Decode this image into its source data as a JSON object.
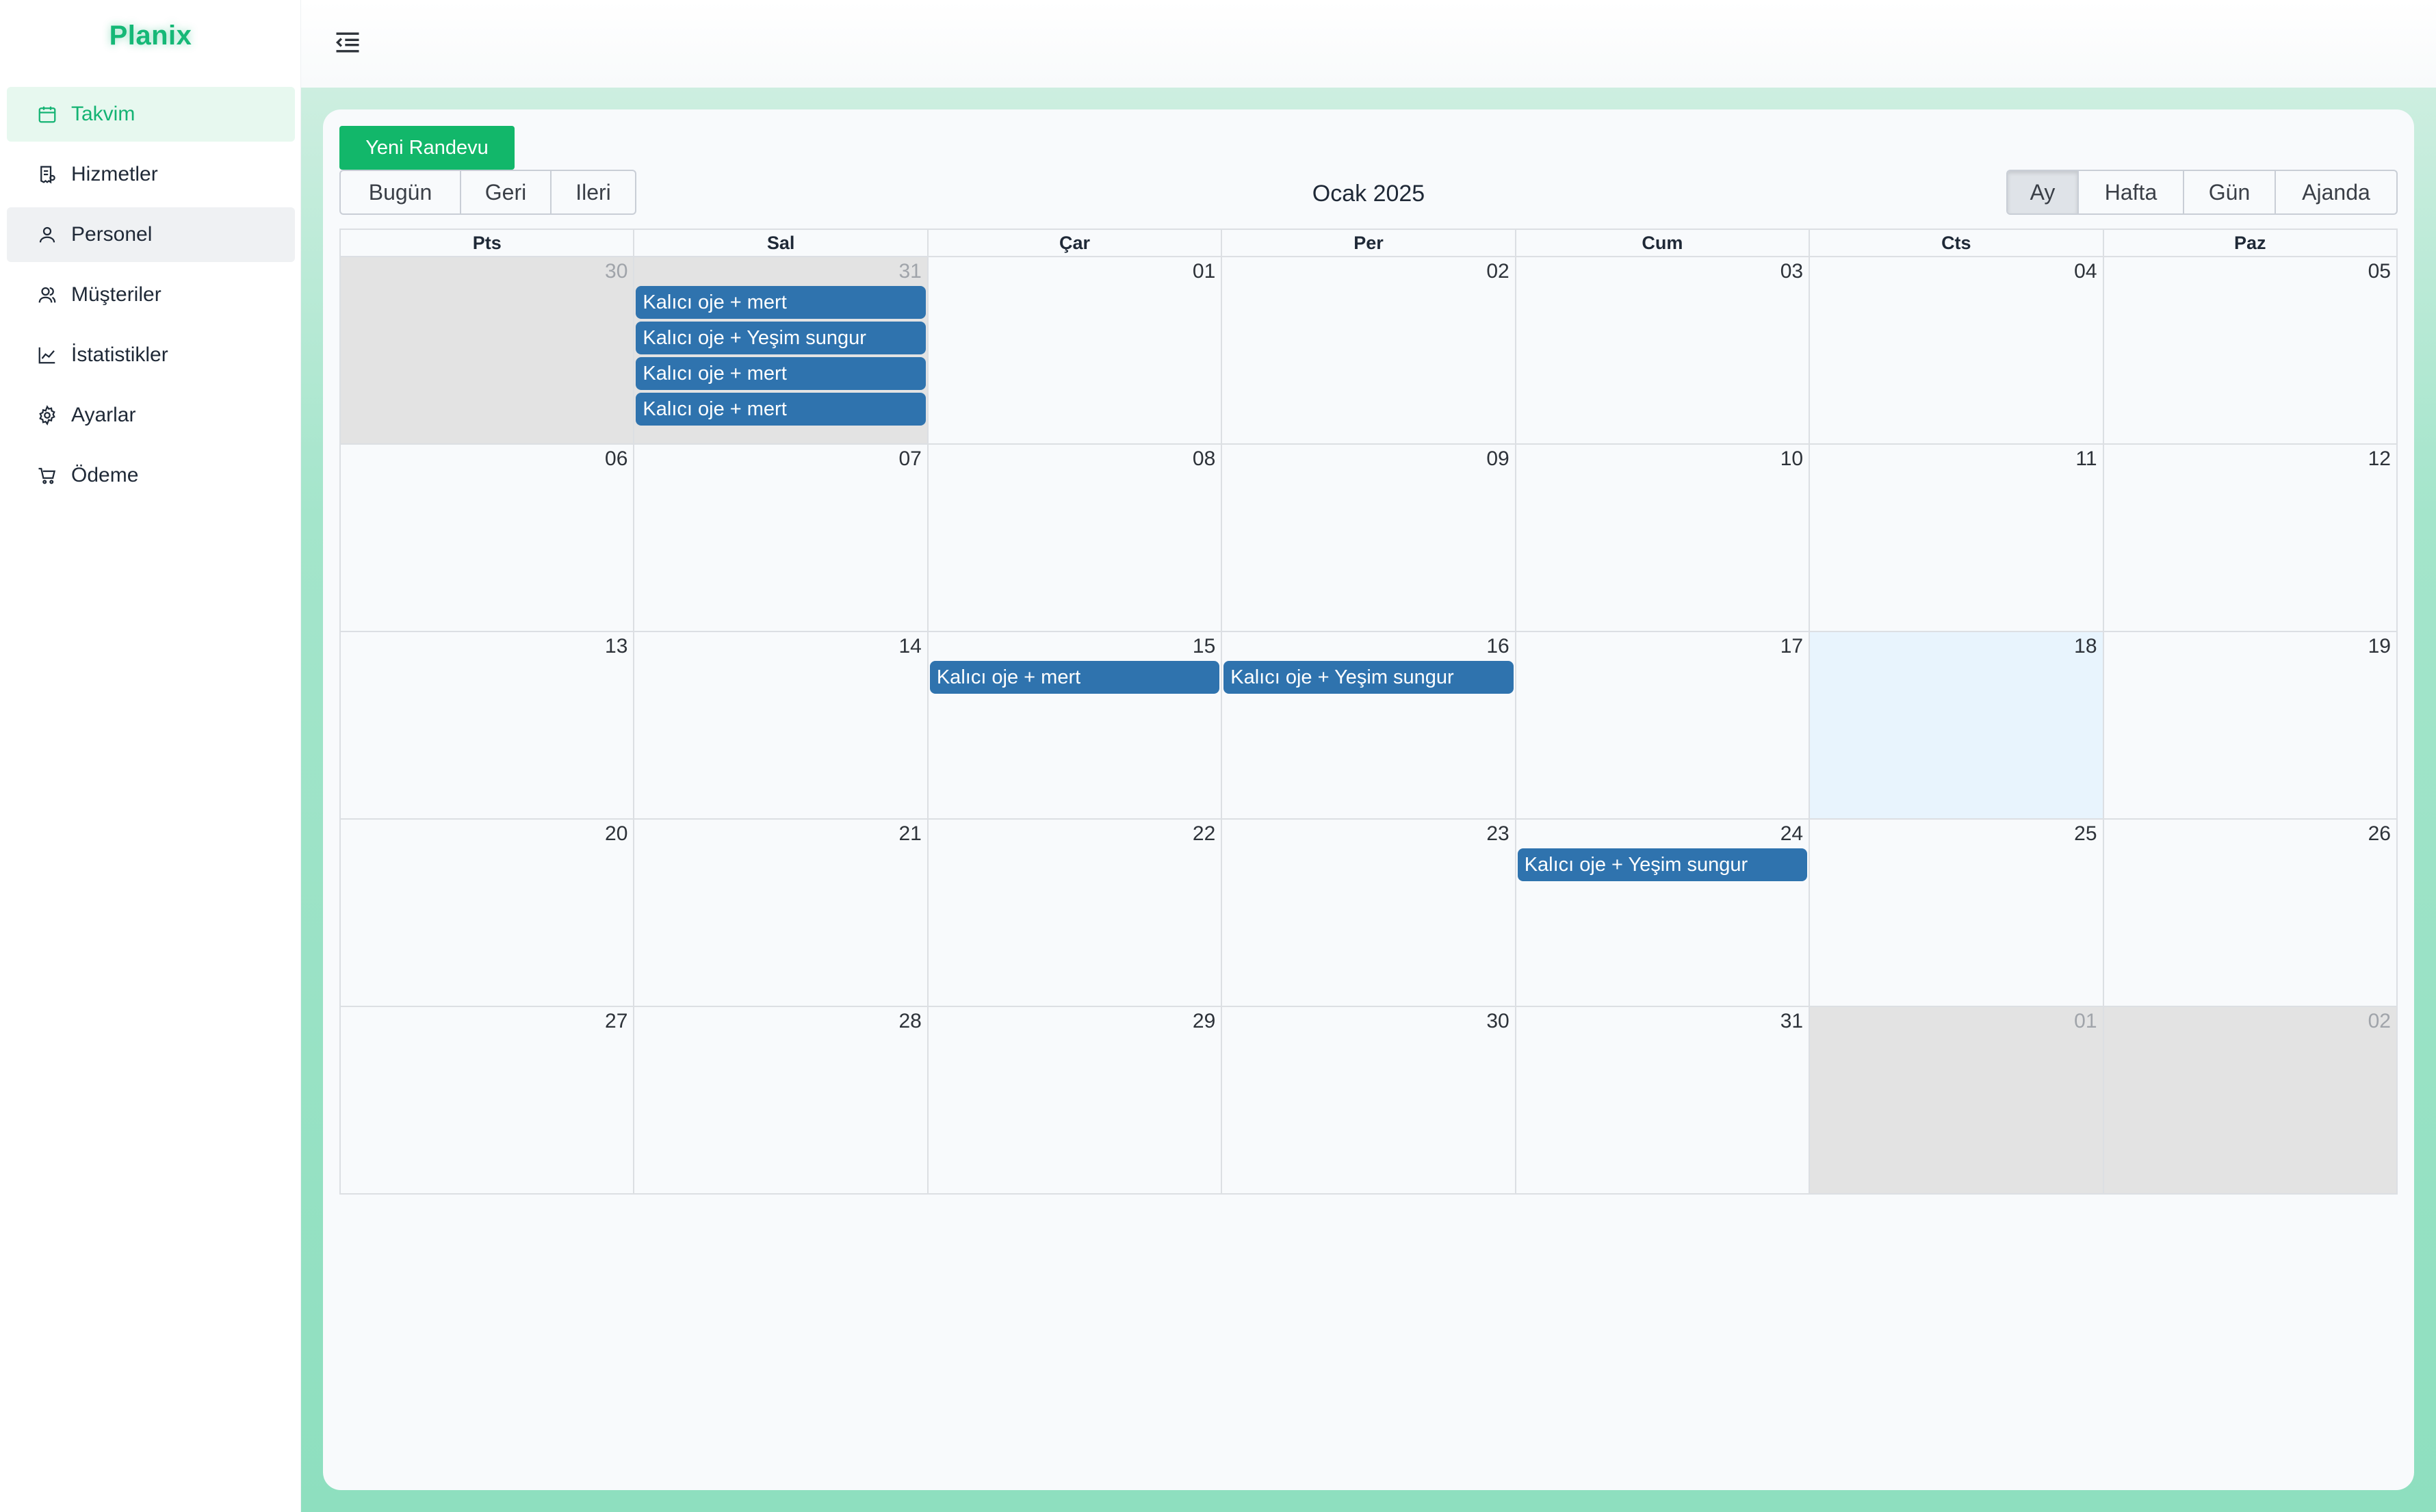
{
  "brand": "Planix",
  "sidebar": {
    "items": [
      {
        "label": "Takvim",
        "icon": "calendar-icon",
        "state": "active"
      },
      {
        "label": "Hizmetler",
        "icon": "receipt-icon",
        "state": ""
      },
      {
        "label": "Personel",
        "icon": "user-icon",
        "state": "hover"
      },
      {
        "label": "Müşteriler",
        "icon": "users-icon",
        "state": ""
      },
      {
        "label": "İstatistikler",
        "icon": "line-chart-icon",
        "state": ""
      },
      {
        "label": "Ayarlar",
        "icon": "gear-icon",
        "state": ""
      },
      {
        "label": "Ödeme",
        "icon": "cart-icon",
        "state": ""
      }
    ]
  },
  "toolbar": {
    "new_appointment": "Yeni Randevu",
    "today": "Bugün",
    "back": "Geri",
    "next": "Ileri",
    "title": "Ocak 2025",
    "views": [
      {
        "label": "Ay",
        "selected": true
      },
      {
        "label": "Hafta",
        "selected": false
      },
      {
        "label": "Gün",
        "selected": false
      },
      {
        "label": "Ajanda",
        "selected": false
      }
    ]
  },
  "calendar": {
    "weekdays": [
      "Pts",
      "Sal",
      "Çar",
      "Per",
      "Cum",
      "Cts",
      "Paz"
    ],
    "weeks": [
      [
        {
          "day": "30",
          "off": true,
          "events": []
        },
        {
          "day": "31",
          "off": true,
          "events": [
            "Kalıcı oje + mert",
            "Kalıcı oje + Yeşim sungur",
            "Kalıcı oje + mert",
            "Kalıcı oje + mert"
          ]
        },
        {
          "day": "01",
          "events": []
        },
        {
          "day": "02",
          "events": []
        },
        {
          "day": "03",
          "events": []
        },
        {
          "day": "04",
          "events": []
        },
        {
          "day": "05",
          "events": []
        }
      ],
      [
        {
          "day": "06",
          "events": []
        },
        {
          "day": "07",
          "events": []
        },
        {
          "day": "08",
          "events": []
        },
        {
          "day": "09",
          "events": []
        },
        {
          "day": "10",
          "events": []
        },
        {
          "day": "11",
          "events": []
        },
        {
          "day": "12",
          "events": []
        }
      ],
      [
        {
          "day": "13",
          "events": []
        },
        {
          "day": "14",
          "events": []
        },
        {
          "day": "15",
          "events": [
            "Kalıcı oje + mert"
          ]
        },
        {
          "day": "16",
          "events": [
            "Kalıcı oje + Yeşim sungur"
          ]
        },
        {
          "day": "17",
          "events": []
        },
        {
          "day": "18",
          "today": true,
          "events": []
        },
        {
          "day": "19",
          "events": []
        }
      ],
      [
        {
          "day": "20",
          "events": []
        },
        {
          "day": "21",
          "events": []
        },
        {
          "day": "22",
          "events": []
        },
        {
          "day": "23",
          "events": []
        },
        {
          "day": "24",
          "events": [
            "Kalıcı oje + Yeşim sungur"
          ]
        },
        {
          "day": "25",
          "events": []
        },
        {
          "day": "26",
          "events": []
        }
      ],
      [
        {
          "day": "27",
          "events": []
        },
        {
          "day": "28",
          "events": []
        },
        {
          "day": "29",
          "events": []
        },
        {
          "day": "30",
          "events": []
        },
        {
          "day": "31",
          "events": []
        },
        {
          "day": "01",
          "off": true,
          "events": []
        },
        {
          "day": "02",
          "off": true,
          "events": []
        }
      ]
    ]
  },
  "colors": {
    "brand": "#16b877",
    "primary_button": "#12b76a",
    "event": "#2f73ae",
    "today": "#e8f4fd",
    "off_month": "#e3e3e3"
  }
}
